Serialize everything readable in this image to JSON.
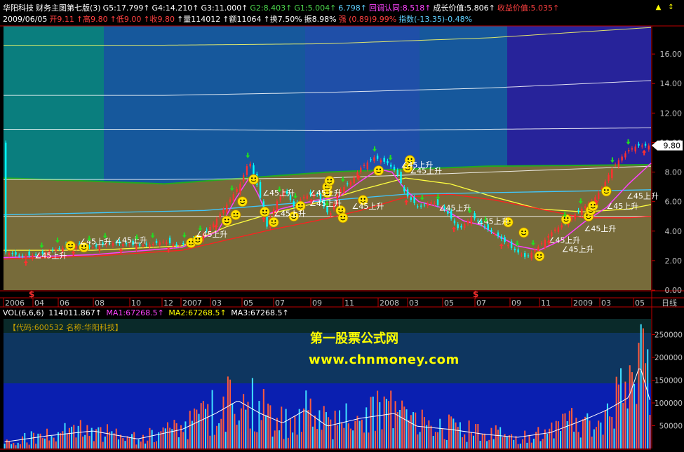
{
  "header": {
    "row1": [
      {
        "text": "华阳科技",
        "color": "#ffffff"
      },
      {
        "text": "财务主图第七版(3)",
        "color": "#ffffff"
      },
      {
        "text": "G5:17.799↑",
        "color": "#ffffff"
      },
      {
        "text": "G4:14.210↑",
        "color": "#ffffff"
      },
      {
        "text": "G3:11.000↑",
        "color": "#ffffff"
      },
      {
        "text": "G2:8.403↑",
        "color": "#4dd84d"
      },
      {
        "text": "G1:5.004↑",
        "color": "#4dd84d"
      },
      {
        "text": "6.798↑",
        "color": "#5fd0ff"
      },
      {
        "text": "回调认同:8.518↑",
        "color": "#ff44ff"
      },
      {
        "text": "成长价值:5.806↑",
        "color": "#ffffff"
      },
      {
        "text": "收益价值:5.035↑",
        "color": "#ff4040"
      }
    ],
    "row2": [
      {
        "text": "2009/06/05",
        "color": "#ffffff"
      },
      {
        "text": "开9.11",
        "color": "#ff4040"
      },
      {
        "text": "↑高9.80",
        "color": "#ff4040"
      },
      {
        "text": "↑低9.00",
        "color": "#ff4040"
      },
      {
        "text": "↑收9.80",
        "color": "#ff4040"
      },
      {
        "text": "↑量114012",
        "color": "#ffffff"
      },
      {
        "text": "↑额11064",
        "color": "#ffffff"
      },
      {
        "text": "↑换7.50%",
        "color": "#ffffff"
      },
      {
        "text": "振8.98%",
        "color": "#ffffff"
      },
      {
        "text": "强 (0.89)9.99%",
        "color": "#ff4040"
      },
      {
        "text": "指数(-13.35)-0.48%",
        "color": "#5fd0ff"
      }
    ],
    "buttons": [
      "▲",
      "↕"
    ]
  },
  "price_badge": "9.80",
  "axis_corner_label": "日线",
  "volume": {
    "label": "VOL(6,6,6)",
    "value": "114011.867↑",
    "ma1": "MA1:67268.5↑",
    "ma2": "MA2:67268.5↑",
    "ma3": "MA3:67268.5↑",
    "code_box": "【代码:600532 名称:华阳科技】"
  },
  "watermark": {
    "line1": "第一股票公式网",
    "line2": "www.chnmoney.com"
  },
  "annotation_text": "∠45上升",
  "dollar_marker": "$",
  "colors": {
    "bg": "#000000",
    "up": "#ff3030",
    "down": "#00ffff",
    "axis": "#c00000",
    "axis_text": "#c0c0c0",
    "channel_fill": "#776b3a",
    "band_dark": "#1a2f90",
    "band_teal": "#0a7e7e",
    "band_blue": "#16589c",
    "band_mid": "#1f4fa8",
    "band_purple": "#27239a"
  },
  "chart_data": [
    {
      "type": "line",
      "title": "华阳科技 财务主图第七版(3)",
      "x_labels": [
        "2006",
        "04",
        "06",
        "08",
        "10",
        "12",
        "2007",
        "03",
        "05",
        "07",
        "09",
        "11",
        "2008",
        "03",
        "05",
        "07",
        "09",
        "11",
        "2009",
        "03",
        "05"
      ],
      "y_ticks": [
        0.0,
        2.0,
        4.0,
        6.0,
        8.0,
        10.0,
        12.0,
        14.0,
        16.0
      ],
      "ylim": [
        0,
        18
      ],
      "price_series": {
        "name": "close",
        "x": [
          0,
          8,
          16,
          24,
          32,
          40,
          48,
          56,
          60,
          66,
          72,
          78,
          82,
          88,
          94,
          100,
          106,
          110,
          114,
          118,
          122,
          126,
          130,
          134,
          140,
          146,
          150,
          156,
          160,
          166,
          172,
          176,
          180,
          186,
          192,
          198,
          204,
          210,
          216,
          222,
          228,
          234,
          240,
          246,
          252,
          258,
          264,
          268,
          272,
          276,
          280,
          284,
          290
        ],
        "values": [
          2.6,
          2.3,
          2.4,
          2.8,
          3.0,
          2.9,
          3.2,
          3.1,
          3.0,
          3.1,
          3.3,
          3.0,
          3.2,
          3.6,
          4.5,
          5.8,
          7.2,
          8.8,
          6.9,
          4.3,
          5.9,
          6.8,
          5.7,
          6.3,
          6.6,
          5.0,
          6.7,
          7.4,
          8.3,
          9.0,
          8.6,
          8.0,
          6.5,
          5.6,
          6.0,
          5.4,
          4.1,
          5.0,
          4.2,
          3.6,
          2.8,
          2.2,
          3.0,
          4.0,
          4.6,
          5.4,
          6.1,
          6.9,
          8.1,
          8.9,
          9.5,
          9.8,
          9.8
        ]
      },
      "moving_averages": [
        {
          "name": "yellow",
          "x": [
            0,
            40,
            80,
            100,
            120,
            140,
            160,
            180,
            200,
            220,
            240,
            260,
            280,
            290
          ],
          "values": [
            2.7,
            2.7,
            3.0,
            4.3,
            5.2,
            5.9,
            6.8,
            7.6,
            7.2,
            6.3,
            5.5,
            5.3,
            5.5,
            5.8
          ]
        },
        {
          "name": "red",
          "x": [
            0,
            40,
            80,
            100,
            120,
            140,
            160,
            180,
            200,
            220,
            240,
            260,
            280,
            290
          ],
          "values": [
            2.1,
            2.3,
            2.7,
            3.4,
            4.1,
            4.7,
            5.4,
            6.3,
            6.5,
            6.1,
            5.5,
            4.9,
            4.9,
            5.0
          ]
        },
        {
          "name": "cyan",
          "x": [
            0,
            90,
            180,
            290
          ],
          "values": [
            5.1,
            5.4,
            6.5,
            6.8
          ]
        },
        {
          "name": "magenta",
          "x": [
            0,
            40,
            80,
            96,
            104,
            110,
            114,
            118,
            124,
            140,
            150,
            160,
            168,
            174,
            180,
            186,
            196,
            206,
            214,
            220,
            230,
            240,
            250,
            260,
            270,
            280,
            290
          ],
          "values": [
            2.2,
            2.4,
            2.9,
            4.0,
            6.2,
            7.6,
            6.5,
            5.1,
            5.5,
            6.1,
            6.3,
            7.4,
            8.2,
            8.0,
            6.8,
            6.0,
            5.6,
            4.7,
            4.4,
            3.8,
            3.0,
            2.7,
            3.4,
            4.6,
            5.6,
            7.2,
            8.6
          ]
        }
      ],
      "guide_lines": [
        {
          "name": "G5",
          "values": [
            16.6,
            16.6,
            16.7,
            17.1,
            17.8
          ]
        },
        {
          "name": "G4",
          "values": [
            13.2,
            13.2,
            13.4,
            13.7,
            14.2
          ]
        },
        {
          "name": "G3",
          "values": [
            10.9,
            10.9,
            10.8,
            10.9,
            11.0
          ]
        },
        {
          "name": "G2",
          "values": [
            7.5,
            7.5,
            7.6,
            8.0,
            8.4
          ]
        },
        {
          "name": "G1",
          "values": [
            5.0,
            5.0,
            5.0,
            5.0,
            5.0
          ]
        }
      ],
      "channel": {
        "top": [
          7.6,
          7.2,
          8.0,
          8.4,
          8.5
        ],
        "bottom": [
          0.0,
          0.0,
          0.0,
          0.0,
          0.0
        ]
      },
      "latest_price": 9.8
    },
    {
      "type": "bar",
      "title": "VOL(6,6,6)",
      "y_ticks": [
        50000,
        100000,
        150000,
        200000,
        250000
      ],
      "ylim": [
        0,
        280000
      ],
      "latest": 114011.867,
      "ma": 67268.5,
      "volume_envelope": {
        "x": [
          0,
          20,
          40,
          60,
          80,
          95,
          105,
          115,
          125,
          135,
          145,
          160,
          175,
          185,
          200,
          215,
          230,
          245,
          260,
          270,
          280,
          285,
          290
        ],
        "values": [
          20000,
          40000,
          55000,
          30000,
          60000,
          110000,
          150000,
          110000,
          80000,
          120000,
          70000,
          95000,
          110000,
          70000,
          60000,
          45000,
          35000,
          50000,
          90000,
          120000,
          160000,
          260000,
          140000
        ]
      }
    }
  ]
}
